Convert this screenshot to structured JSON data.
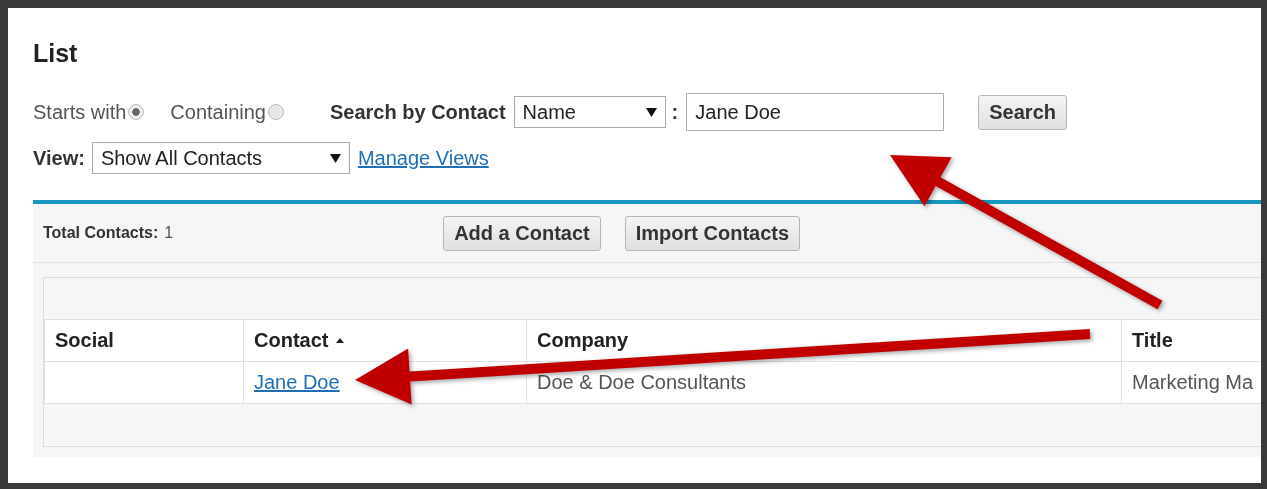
{
  "title": "List",
  "search_mode": [
    {
      "label": "Starts with",
      "selected": true
    },
    {
      "label": "Containing",
      "selected": false
    }
  ],
  "search_by": {
    "label": "Search by Contact",
    "field": "Name",
    "separator": ":",
    "value": "Jane Doe",
    "button": "Search"
  },
  "view": {
    "label": "View:",
    "value": "Show All Contacts",
    "link": "Manage Views"
  },
  "toolbar": {
    "total_label": "Total Contacts:",
    "total": "1",
    "buttons": [
      "Add a Contact",
      "Import Contacts"
    ]
  },
  "table": {
    "columns": [
      {
        "label": "Social",
        "sorted": false
      },
      {
        "label": "Contact",
        "sorted": true
      },
      {
        "label": "Company",
        "sorted": false
      },
      {
        "label": "Title",
        "sorted": false
      }
    ],
    "rows": [
      {
        "social": "",
        "contact": "Jane Doe",
        "company": "Doe & Doe Consultants",
        "title": "Marketing Ma"
      }
    ]
  }
}
